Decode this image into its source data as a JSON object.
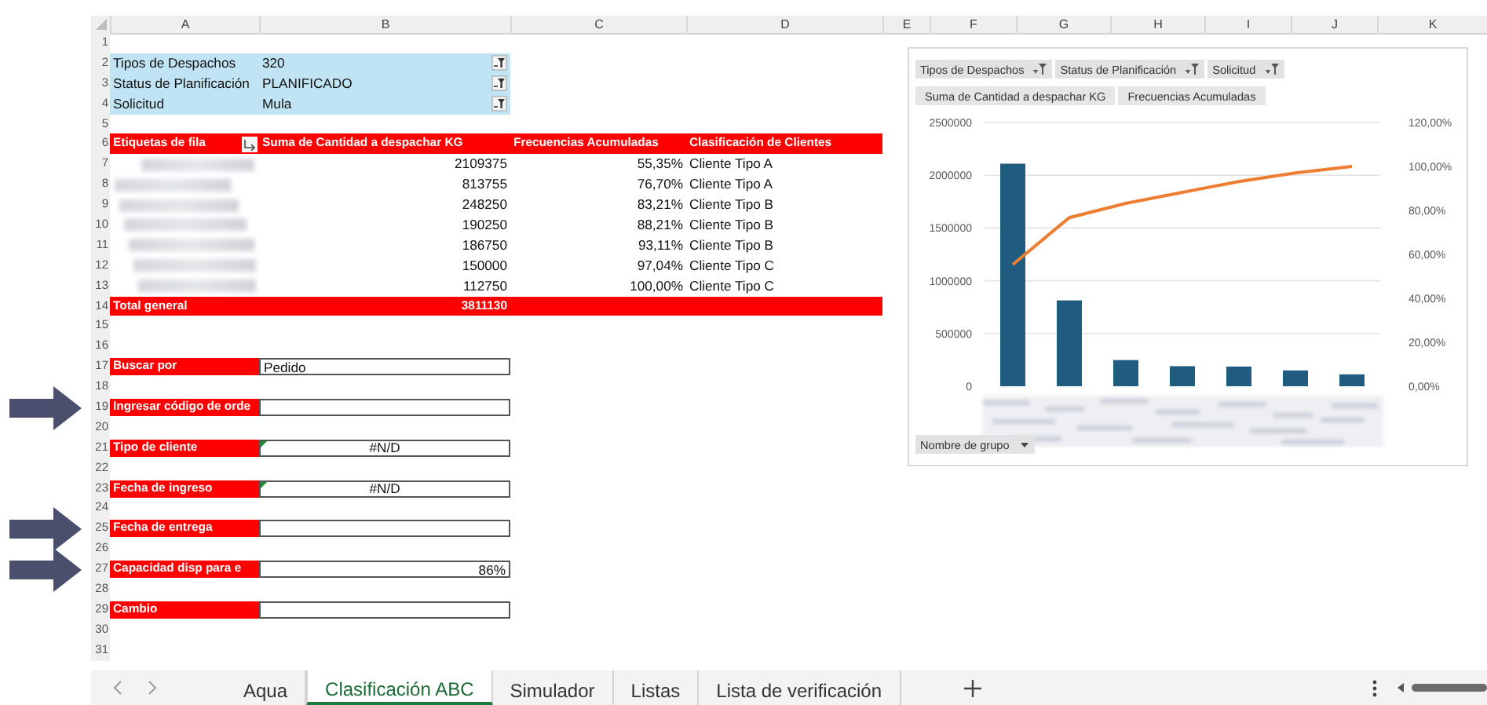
{
  "column_headers": [
    "A",
    "B",
    "C",
    "D",
    "E",
    "F",
    "G",
    "H",
    "I",
    "J",
    "K"
  ],
  "row_numbers": [
    "1",
    "2",
    "3",
    "4",
    "5",
    "6",
    "7",
    "8",
    "9",
    "10",
    "11",
    "12",
    "13",
    "14",
    "15",
    "16",
    "17",
    "18",
    "19",
    "20",
    "21",
    "22",
    "23",
    "24",
    "25",
    "26",
    "27",
    "28",
    "29",
    "30",
    "31"
  ],
  "filters": [
    {
      "label": "Tipos de Despachos",
      "value": "320"
    },
    {
      "label": "Status de Planificación",
      "value": "PLANIFICADO"
    },
    {
      "label": "Solicitud",
      "value": "Mula"
    }
  ],
  "pivot": {
    "headers": [
      "Etiquetas de fila",
      "Suma de Cantidad a despachar KG",
      "Frecuencias Acumuladas",
      "Clasificación de Clientes"
    ],
    "rows": [
      {
        "amount": "2109375",
        "cumulative": "55,35%",
        "class": "Cliente Tipo A"
      },
      {
        "amount": "813755",
        "cumulative": "76,70%",
        "class": "Cliente Tipo A"
      },
      {
        "amount": "248250",
        "cumulative": "83,21%",
        "class": "Cliente Tipo B"
      },
      {
        "amount": "190250",
        "cumulative": "88,21%",
        "class": "Cliente Tipo B"
      },
      {
        "amount": "186750",
        "cumulative": "93,11%",
        "class": "Cliente Tipo B"
      },
      {
        "amount": "150000",
        "cumulative": "97,04%",
        "class": "Cliente Tipo C"
      },
      {
        "amount": "112750",
        "cumulative": "100,00%",
        "class": "Cliente Tipo C"
      }
    ],
    "total": {
      "label": "Total general",
      "amount": "3811130"
    }
  },
  "form_fields": [
    {
      "label": "Buscar por",
      "value": "Pedido",
      "kind": "text",
      "arrow": false,
      "flag": false
    },
    {
      "label": "Ingresar código de orde",
      "kind": "text",
      "arrow": true,
      "flag": false
    },
    {
      "label": "Tipo de cliente",
      "value": "#N/D",
      "kind": "error",
      "arrow": false,
      "flag": true
    },
    {
      "label": "Fecha de ingreso",
      "value": "#N/D",
      "kind": "error",
      "arrow": false,
      "flag": true
    },
    {
      "label": "Fecha de entrega",
      "kind": "text",
      "arrow": true,
      "flag": false
    },
    {
      "label": "Capacidad disp para e",
      "value": "86%",
      "kind": "number",
      "arrow": true,
      "flag": false
    },
    {
      "label": "Cambio",
      "kind": "text",
      "arrow": false,
      "flag": false
    }
  ],
  "chart": {
    "field_buttons": [
      "Tipos de Despachos",
      "Status de Planificación",
      "Solicitud"
    ],
    "axis_button": "Nombre de grupo",
    "chart_data": {
      "type": "bar",
      "grid": true,
      "ylim": [
        0,
        2500000
      ],
      "yticks": [
        0,
        500000,
        1000000,
        1500000,
        2000000,
        2500000
      ],
      "y2lim": [
        0,
        120
      ],
      "y2ticks": [
        {
          "value": 0,
          "label": "0,00%"
        },
        {
          "value": 20,
          "label": "20,00%"
        },
        {
          "value": 40,
          "label": "40,00%"
        },
        {
          "value": 60,
          "label": "60,00%"
        },
        {
          "value": 80,
          "label": "80,00%"
        },
        {
          "value": 100,
          "label": "100,00%"
        },
        {
          "value": 120,
          "label": "120,00%"
        }
      ],
      "series": [
        {
          "name": "Suma de Cantidad a despachar KG",
          "color": "#1f5c7f",
          "values": [
            2109375,
            813755,
            248250,
            190250,
            186750,
            150000,
            112750
          ]
        },
        {
          "name": "Frecuencias Acumuladas",
          "type": "line",
          "axis": "y2",
          "color": "#ed7d31",
          "values": [
            55.35,
            76.7,
            83.21,
            88.21,
            93.11,
            97.04,
            100
          ]
        }
      ]
    }
  },
  "sheet_tabs": [
    {
      "label": "Aqua",
      "selected": false
    },
    {
      "label": "Clasificación ABC",
      "selected": true
    },
    {
      "label": "Simulador",
      "selected": false
    },
    {
      "label": "Listas",
      "selected": false
    },
    {
      "label": "Lista de verificación",
      "selected": false
    }
  ]
}
